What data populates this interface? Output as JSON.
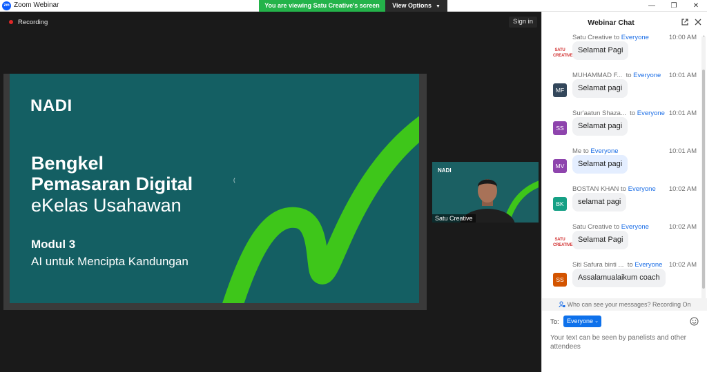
{
  "app": {
    "title": "Zoom Webinar",
    "logo_text": "zm"
  },
  "window_controls": {
    "minimize": "—",
    "restore": "❐",
    "close": "✕"
  },
  "share": {
    "banner": "You are viewing Satu Creative's screen",
    "view_options": "View Options"
  },
  "meeting": {
    "recording": "Recording",
    "sign_in": "Sign in"
  },
  "slide": {
    "logo": "NADI",
    "title_line1": "Bengkel",
    "title_line2": "Pemasaran Digital",
    "title_line3": "eKelas Usahawan",
    "module": "Modul 3",
    "subtitle": "AI untuk Mencipta Kandungan",
    "mark": "("
  },
  "thumbnail": {
    "logo": "NADI",
    "name": "Satu Creative"
  },
  "chat": {
    "title": "Webinar Chat",
    "messages": [
      {
        "sender": "Satu Creative",
        "to": "to",
        "target": "Everyone",
        "time": "10:00 AM",
        "avatar": "SATU\nCREATIVE",
        "avatar_color": "transparent",
        "text": "Selamat Pagi",
        "mine": false,
        "logo": true
      },
      {
        "sender": "MUHAMMAD F...",
        "to": "to",
        "target": "Everyone",
        "time": "10:01 AM",
        "avatar": "MF",
        "avatar_color": "#33475b",
        "text": "Selamat pagi",
        "mine": false,
        "logo": false
      },
      {
        "sender": "Sur'aatun Shaza...",
        "to": "to",
        "target": "Everyone",
        "time": "10:01 AM",
        "avatar": "SS",
        "avatar_color": "#8e44ad",
        "text": "Selamat pagi",
        "mine": false,
        "logo": false
      },
      {
        "sender": "Me",
        "to": "to",
        "target": "Everyone",
        "time": "10:01 AM",
        "avatar": "MV",
        "avatar_color": "#8e44ad",
        "text": "Selamat pagi",
        "mine": true,
        "logo": false
      },
      {
        "sender": "BOSTAN KHAN",
        "to": "to",
        "target": "Everyone",
        "time": "10:02 AM",
        "avatar": "BK",
        "avatar_color": "#16a085",
        "text": "selamat pagi",
        "mine": false,
        "logo": false
      },
      {
        "sender": "Satu Creative",
        "to": "to",
        "target": "Everyone",
        "time": "10:02 AM",
        "avatar": "SATU\nCREATIVE",
        "avatar_color": "transparent",
        "text": "Selamat Pagi",
        "mine": false,
        "logo": true
      },
      {
        "sender": "Siti Safura binti ...",
        "to": "to",
        "target": "Everyone",
        "time": "10:02 AM",
        "avatar": "SS",
        "avatar_color": "#d35400",
        "text": "Assalamualaikum coach",
        "mine": false,
        "logo": false
      }
    ],
    "privacy_notice": "Who can see your messages? Recording On",
    "to_label": "To:",
    "to_value": "Everyone",
    "input_hint": "Your text can be seen by panelists and other attendees"
  },
  "colors": {
    "accent": "#0e71eb",
    "share_green": "#24b34a",
    "slide_bg": "#145f63",
    "swoosh": "#3ec61a"
  }
}
